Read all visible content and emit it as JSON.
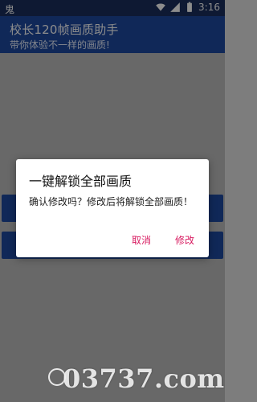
{
  "status_bar": {
    "left_icon_text": "鬼",
    "time": "3:16",
    "icons": [
      "wifi-icon",
      "signal-icon",
      "battery-icon"
    ]
  },
  "header": {
    "title": "校长120帧画质助手",
    "subtitle": "带你体验不一样的画质!"
  },
  "dialog": {
    "title": "一键解锁全部画质",
    "message": "确认修改吗？修改后将解锁全部画质！",
    "cancel_label": "取消",
    "confirm_label": "修改"
  },
  "watermark": {
    "text": "03737.com"
  },
  "colors": {
    "status_bar": "#1a2f5d",
    "header": "#1e4aa1",
    "dialog_button": "#d81b60"
  }
}
